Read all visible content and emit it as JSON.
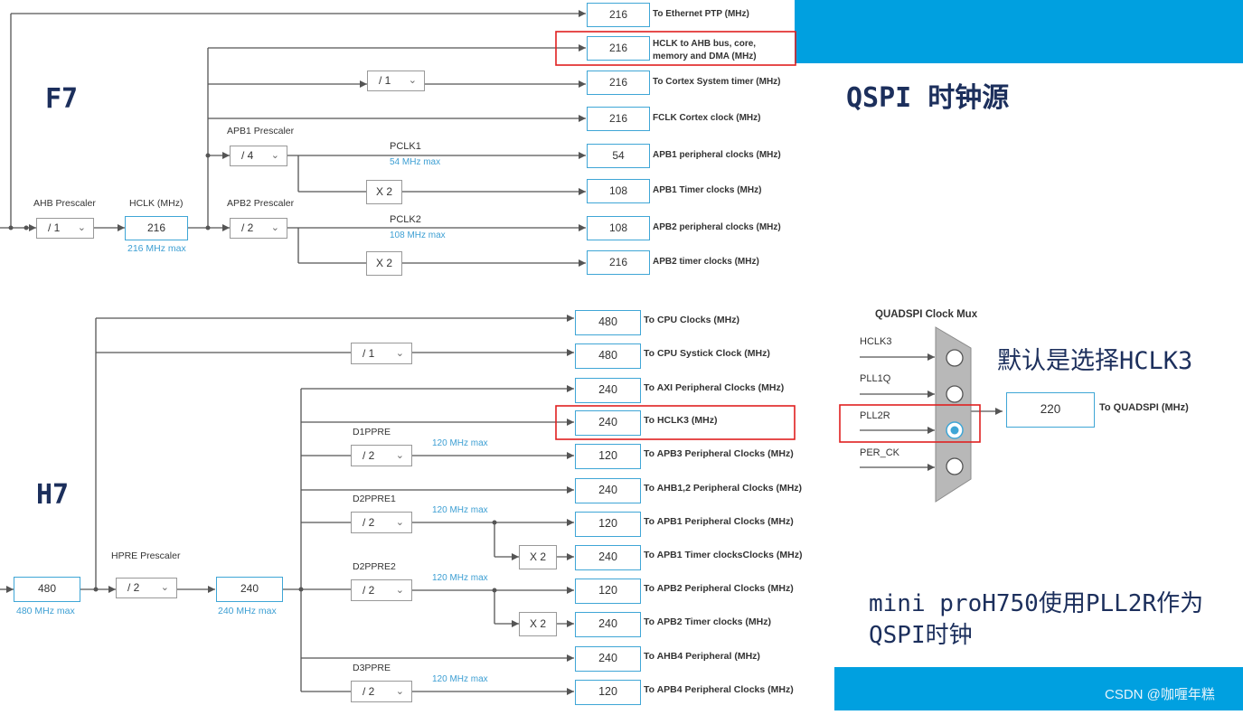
{
  "colors": {
    "accent": "#00a0e0",
    "box_border": "#3fa6d6",
    "highlight": "#e02020",
    "line": "#555555",
    "limit": "#3d9fd3",
    "heading": "#1c2f5c"
  },
  "f7": {
    "title": "F7",
    "ahb_prescaler": {
      "label": "AHB Prescaler",
      "value": "/ 1"
    },
    "hclk": {
      "label": "HCLK (MHz)",
      "value": "216",
      "max": "216 MHz max"
    },
    "apb1_prescaler": {
      "label": "APB1 Prescaler",
      "value": "/ 4"
    },
    "apb2_prescaler": {
      "label": "APB2 Prescaler",
      "value": "/ 2"
    },
    "cortex_div": {
      "value": "/ 1"
    },
    "pclk1": {
      "label": "PCLK1",
      "max": "54 MHz max"
    },
    "pclk2": {
      "label": "PCLK2",
      "max": "108 MHz max"
    },
    "x2a": "X 2",
    "x2b": "X 2",
    "outputs": [
      {
        "value": "216",
        "label": "To Ethernet PTP (MHz)"
      },
      {
        "value": "216",
        "label": "HCLK to AHB bus, core,",
        "label2": "memory and DMA (MHz)"
      },
      {
        "value": "216",
        "label": "To Cortex System timer (MHz)"
      },
      {
        "value": "216",
        "label": "FCLK Cortex clock (MHz)"
      },
      {
        "value": "54",
        "label": "APB1 peripheral clocks (MHz)"
      },
      {
        "value": "108",
        "label": "APB1 Timer clocks (MHz)"
      },
      {
        "value": "108",
        "label": "APB2 peripheral clocks (MHz)"
      },
      {
        "value": "216",
        "label": "APB2 timer clocks (MHz)"
      }
    ]
  },
  "h7": {
    "title": "H7",
    "sysclk": {
      "value": "480",
      "max": "480 MHz max"
    },
    "hpre": {
      "label": "HPRE Prescaler",
      "value": "/ 2"
    },
    "hclk": {
      "value": "240",
      "max": "240 MHz max"
    },
    "systick_div": {
      "value": "/ 1"
    },
    "d1ppre": {
      "label": "D1PPRE",
      "value": "/ 2",
      "max": "120 MHz max"
    },
    "d2ppre1": {
      "label": "D2PPRE1",
      "value": "/ 2",
      "max": "120 MHz max"
    },
    "d2ppre2": {
      "label": "D2PPRE2",
      "value": "/ 2",
      "max": "120 MHz max"
    },
    "d3ppre": {
      "label": "D3PPRE",
      "value": "/ 2",
      "max": "120 MHz max"
    },
    "x2a": "X 2",
    "x2b": "X 2",
    "outputs": [
      {
        "value": "480",
        "label": "To CPU Clocks (MHz)"
      },
      {
        "value": "480",
        "label": "To CPU Systick Clock (MHz)"
      },
      {
        "value": "240",
        "label": "To AXI Peripheral Clocks (MHz)"
      },
      {
        "value": "240",
        "label": "To HCLK3 (MHz)"
      },
      {
        "value": "120",
        "label": "To APB3 Peripheral Clocks (MHz)"
      },
      {
        "value": "240",
        "label": "To AHB1,2 Peripheral Clocks (MHz)"
      },
      {
        "value": "120",
        "label": "To APB1 Peripheral Clocks (MHz)"
      },
      {
        "value": "240",
        "label": "To APB1 Timer clocksClocks (MHz)"
      },
      {
        "value": "120",
        "label": "To APB2 Peripheral Clocks (MHz)"
      },
      {
        "value": "240",
        "label": "To APB2 Timer clocks (MHz)"
      },
      {
        "value": "240",
        "label": "To AHB4 Peripheral (MHz)"
      },
      {
        "value": "120",
        "label": "To APB4 Peripheral Clocks (MHz)"
      }
    ]
  },
  "notes": {
    "qspi_source": "QSPI 时钟源",
    "default_choice": "默认是选择HCLK3",
    "mini_pro_line1": "mini proH750使用PLL2R作为",
    "mini_pro_line2": "QSPI时钟",
    "watermark": "CSDN @咖喱年糕"
  },
  "qspi_mux": {
    "title": "QUADSPI Clock Mux",
    "inputs": [
      "HCLK3",
      "PLL1Q",
      "PLL2R",
      "PER_CK"
    ],
    "selected": "PLL2R",
    "output": {
      "value": "220",
      "label": "To QUADSPI (MHz)"
    }
  }
}
